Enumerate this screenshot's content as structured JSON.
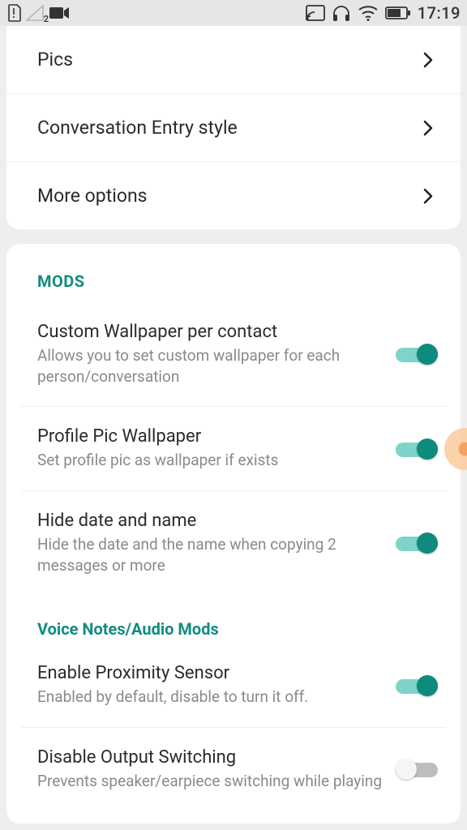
{
  "status": {
    "sim_index": "2",
    "time": "17:19"
  },
  "nav": {
    "pics": "Pics",
    "entry_style": "Conversation Entry style",
    "more": "More options"
  },
  "mods_header": "MODS",
  "mods": {
    "wallpaper": {
      "title": "Custom Wallpaper per contact",
      "sub": "Allows you to set custom wallpaper for each person/conversation",
      "on": true
    },
    "profile_pic": {
      "title": "Profile Pic Wallpaper",
      "sub": "Set profile pic as wallpaper if exists",
      "on": true
    },
    "hide_date": {
      "title": "Hide date and name",
      "sub": "Hide the date and the name when copying 2 messages or more",
      "on": true
    }
  },
  "voice_header": "Voice Notes/Audio Mods",
  "voice": {
    "proximity": {
      "title": "Enable Proximity Sensor",
      "sub": "Enabled by default, disable to turn it off.",
      "on": true
    },
    "output": {
      "title": "Disable Output Switching",
      "sub": "Prevents speaker/earpiece switching while playing",
      "on": false
    }
  }
}
